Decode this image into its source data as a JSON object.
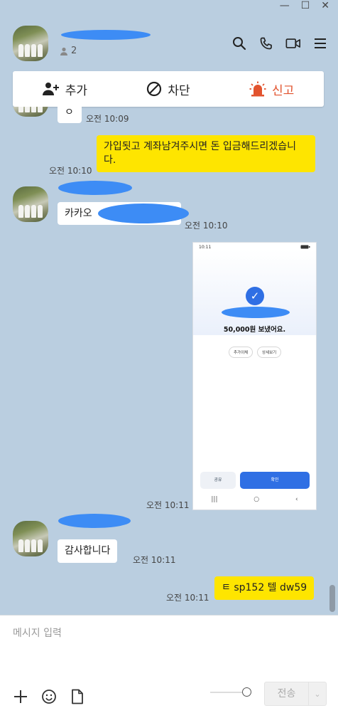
{
  "window": {
    "minimize": "—",
    "maximize": "☐",
    "close": "✕"
  },
  "header": {
    "chat_name": "",
    "member_count": "2"
  },
  "actionbar": {
    "add_label": "추가",
    "block_label": "차단",
    "report_label": "신고"
  },
  "messages": [
    {
      "text": "ㅇ",
      "time": "오전 10:09"
    },
    {
      "text": "가입됫고 계좌남겨주시면 돈 입금해드리겠습니다.",
      "time": "오전 10:10"
    },
    {
      "text": "카카오",
      "time": "오전 10:10"
    },
    {
      "text": "",
      "time": "오전 10:11"
    },
    {
      "text": "감사합니다",
      "time": "오전 10:11"
    },
    {
      "text": "ㅌ sp152 텔 dw59",
      "time": "오전 10:11"
    }
  ],
  "screenshot": {
    "status_time": "10:11",
    "amount_text": "50,000원 보냈어요.",
    "pill_left": "추가이체",
    "pill_right": "상세보기",
    "btn_share": "공유",
    "btn_confirm": "확인"
  },
  "composer": {
    "placeholder": "메시지 입력",
    "send_label": "전송"
  },
  "colors": {
    "background": "#bacee0",
    "my_bubble": "#fee500",
    "report": "#e2532e",
    "confirm": "#2f6fe4"
  }
}
